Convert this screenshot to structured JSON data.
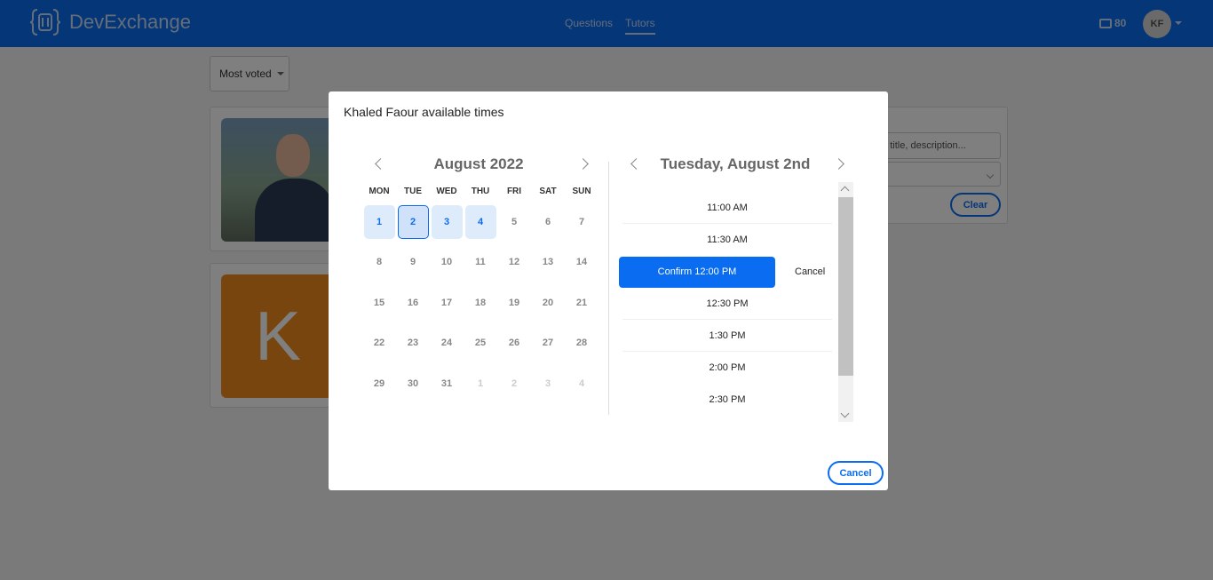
{
  "app": {
    "name": "DevExchange",
    "nav": [
      "Questions",
      "Tutors"
    ],
    "active_nav": "Tutors",
    "credits": "80",
    "user_initials": "KF",
    "accent": "#0a6cf0"
  },
  "page": {
    "sort_label": "Most voted",
    "filter_placeholder": "e, title, description...",
    "clear_label": "Clear",
    "card2_initial": "K"
  },
  "modal": {
    "title": "Khaled Faour available times",
    "calendar": {
      "month_label": "August 2022",
      "weekdays": [
        "MON",
        "TUE",
        "WED",
        "THU",
        "FRI",
        "SAT",
        "SUN"
      ],
      "weeks": [
        [
          "1",
          "2",
          "3",
          "4",
          "5",
          "6",
          "7"
        ],
        [
          "8",
          "9",
          "10",
          "11",
          "12",
          "13",
          "14"
        ],
        [
          "15",
          "16",
          "17",
          "18",
          "19",
          "20",
          "21"
        ],
        [
          "22",
          "23",
          "24",
          "25",
          "26",
          "27",
          "28"
        ],
        [
          "29",
          "30",
          "31",
          "1",
          "2",
          "3",
          "4"
        ]
      ],
      "available_days": [
        "1",
        "2",
        "3",
        "4"
      ],
      "selected_day": "2"
    },
    "day_label": "Tuesday, August 2nd",
    "slots": [
      "11:00 AM",
      "11:30 AM",
      "12:30 PM",
      "1:30 PM",
      "2:00 PM",
      "2:30 PM"
    ],
    "confirm_label": "Confirm 12:00 PM",
    "slot_cancel_label": "Cancel",
    "cancel_label": "Cancel"
  }
}
